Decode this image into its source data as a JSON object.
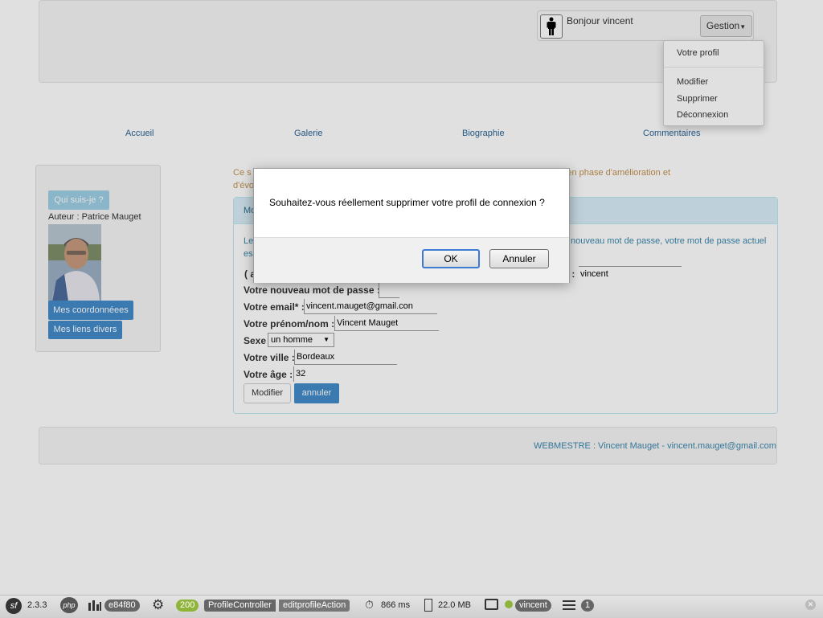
{
  "header": {
    "greeting": "Bonjour vincent",
    "menu_button": "Gestion",
    "dropdown": [
      "Votre profil",
      "Modifier",
      "Supprimer",
      "Déconnexion"
    ]
  },
  "nav": [
    "Accueil",
    "Galerie",
    "Biographie",
    "Commentaires"
  ],
  "intro": {
    "left": "Ce s",
    "left2": "d'évo",
    "right": "re du Médoc. Il reste en phase d'amélioration et"
  },
  "sidebar": {
    "who_button": "Qui suis-je ?",
    "author": "Auteur : Patrice Mauget",
    "buttons": [
      "Mes coordonnéees",
      "Mes liens divers"
    ]
  },
  "form": {
    "title": "Mo",
    "info_left": "Le",
    "info_left2": "es",
    "info_right": "nouveau mot de passe, votre mot de passe actuel",
    "row0_left": "( a",
    "row0_right": ") :",
    "login_value": "vincent",
    "fields": [
      {
        "label": "Votre nouveau mot de passe :",
        "value": ""
      },
      {
        "label": "Votre email* :",
        "value": "vincent.mauget@gmail.con"
      },
      {
        "label": "Votre prénom/nom :",
        "value": "Vincent Mauget"
      },
      {
        "label": "Sexe",
        "value": "un homme"
      },
      {
        "label": "Votre ville :",
        "value": "Bordeaux"
      },
      {
        "label": "Votre âge :",
        "value": "32"
      }
    ],
    "submit": "Modifier",
    "cancel": "annuler"
  },
  "footer": "WEBMESTRE : Vincent Mauget - vincent.mauget@gmail.com",
  "dialog": {
    "message": "Souhaitez-vous réellement supprimer votre profil de connexion ?",
    "ok": "OK",
    "cancel": "Annuler"
  },
  "toolbar": {
    "version": "2.3.3",
    "php": "php",
    "token": "e84f80",
    "status": "200",
    "controller": "ProfileController",
    "action": "editprofileAction",
    "time": "866 ms",
    "memory": "22.0 MB",
    "user": "vincent",
    "count": "1"
  },
  "colors": {
    "link": "#2a6496",
    "primary": "#428bca",
    "status_ok": "#8fb43a"
  }
}
